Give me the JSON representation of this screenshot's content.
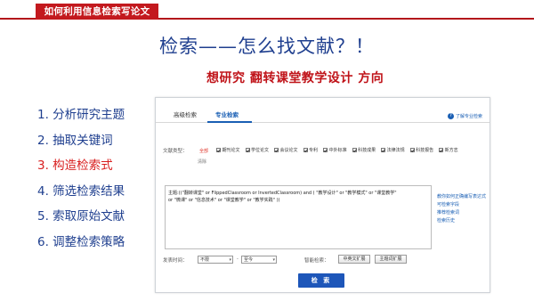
{
  "header": {
    "tab_label": "如何利用信息检索写论文"
  },
  "slide": {
    "title": "检索——怎么找文献？！",
    "topic": "想研究  翻转课堂教学设计  方向"
  },
  "steps": [
    {
      "label": "1. 分析研究主题",
      "active": false
    },
    {
      "label": "2. 抽取关键词",
      "active": false
    },
    {
      "label": "3. 构造检索式",
      "active": true
    },
    {
      "label": "4. 筛选检索结果",
      "active": false
    },
    {
      "label": "5. 索取原始文献",
      "active": false
    },
    {
      "label": "6. 调整检索策略",
      "active": false
    }
  ],
  "panel": {
    "tabs": [
      "高级检索",
      "专业检索"
    ],
    "active_tab": "专业检索",
    "help_label": "了解专业检索",
    "doc_type_label": "文献类型：",
    "all_label": "全部",
    "clear_label": "清除",
    "doc_types": [
      "期刊论文",
      "学位论文",
      "会议论文",
      "专利",
      "中外标准",
      "科技成果",
      "法律法规",
      "科技报告",
      "新方志"
    ],
    "query_line1": "主题:((\"翻转课堂\"  or  FlippedClassroom or InvertedClassroom) and ( \"教学设计\"  or  \"教学模式\"  or  \"课堂教学\"",
    "query_line2": "or  \"微课\"  or  \"信息技术\"  or  \"课堂教学\"  or  \"教学实践\"  ))",
    "side_links": [
      "教你如何正确编写表达式",
      "可检索字段",
      "推荐检索词",
      "检索历史"
    ],
    "pub_time_label": "发表时间：",
    "from_value": "不限",
    "dash": "-",
    "to_value": "至今",
    "smart_label": "智能检索：",
    "smart_btn1": "中英文扩展",
    "smart_btn2": "主题词扩展",
    "search_btn": "检 索"
  },
  "colors": {
    "title_blue": "#1f3f8f",
    "accent_red": "#c3191e",
    "link_blue": "#1a5fb4",
    "button_blue": "#1d56b9"
  }
}
